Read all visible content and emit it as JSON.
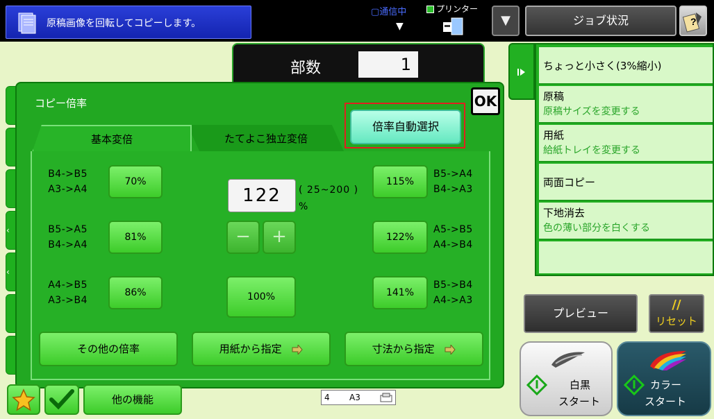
{
  "header": {
    "message": "原稿画像を回転してコピーします。",
    "comm_status": "▢通信中",
    "printer_label": "プリンター",
    "dropdown_glyph": "▼",
    "job_status_label": "ジョブ状況"
  },
  "copies": {
    "label": "部数",
    "value": "1"
  },
  "panel": {
    "title": "コピー倍率",
    "ok_label": "OK",
    "auto_select_label": "倍率自動選択",
    "tab_basic": "基本変倍",
    "tab_xy": "たてよこ独立変倍",
    "ratio_value": "122",
    "range_text": "( 25~200 )",
    "unit": "%",
    "minus": "−",
    "plus": "+",
    "reset_100": "100%",
    "left_presets": [
      {
        "line1": "B4->B5",
        "line2": "A3->A4",
        "value": "70%"
      },
      {
        "line1": "B5->A5",
        "line2": "B4->A4",
        "value": "81%"
      },
      {
        "line1": "A4->B5",
        "line2": "A3->B4",
        "value": "86%"
      }
    ],
    "right_presets": [
      {
        "line1": "B5->A4",
        "line2": "B4->A3",
        "value": "115%"
      },
      {
        "line1": "A5->B5",
        "line2": "A4->B4",
        "value": "122%"
      },
      {
        "line1": "B5->B4",
        "line2": "A4->A3",
        "value": "141%"
      }
    ],
    "other_ratio": "その他の倍率",
    "from_paper": "用紙から指定",
    "from_size": "寸法から指定"
  },
  "right_menu": [
    {
      "title": "ちょっと小さく(3%縮小)",
      "sub": ""
    },
    {
      "title": "原稿",
      "sub": "原稿サイズを変更する"
    },
    {
      "title": "用紙",
      "sub": "給紙トレイを変更する"
    },
    {
      "title": "両面コピー",
      "sub": ""
    },
    {
      "title": "下地消去",
      "sub": "色の薄い部分を白くする"
    }
  ],
  "actions": {
    "preview": "プレビュー",
    "reset_glyph": "//",
    "reset": "リセット",
    "bw_line1": "白黒",
    "bw_line2": "スタート",
    "color_line1": "カラー",
    "color_line2": "スタート"
  },
  "footer": {
    "other_functions": "他の機能",
    "tray_num": "4",
    "tray_size": "A3"
  },
  "colors": {
    "panel_green": "#22a822",
    "button_green": "#5ee04a",
    "auto_cyan": "#8ef5d4",
    "highlight_red": "#e02020",
    "message_blue": "#1a2fc8"
  }
}
